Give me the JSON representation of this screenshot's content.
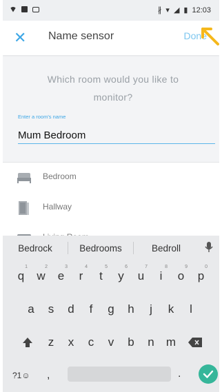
{
  "status_bar": {
    "time": "12:03"
  },
  "app_bar": {
    "title": "Name sensor",
    "done_label": "Done"
  },
  "prompt": {
    "question": "Which room would you like to monitor?"
  },
  "field": {
    "label": "Enter a room's name",
    "value": "Mum Bedroom"
  },
  "rooms": [
    {
      "label": "Bedroom",
      "icon": "bed-icon"
    },
    {
      "label": "Hallway",
      "icon": "door-icon"
    },
    {
      "label": "Living Room",
      "icon": "sofa-icon"
    }
  ],
  "keyboard": {
    "suggestions": [
      "Bedrock",
      "Bedrooms",
      "Bedroll"
    ],
    "row1": [
      {
        "k": "q",
        "h": "1"
      },
      {
        "k": "w",
        "h": "2"
      },
      {
        "k": "e",
        "h": "3"
      },
      {
        "k": "r",
        "h": "4"
      },
      {
        "k": "t",
        "h": "5"
      },
      {
        "k": "y",
        "h": "6"
      },
      {
        "k": "u",
        "h": "7"
      },
      {
        "k": "i",
        "h": "8"
      },
      {
        "k": "o",
        "h": "9"
      },
      {
        "k": "p",
        "h": "0"
      }
    ],
    "row2": [
      "a",
      "s",
      "d",
      "f",
      "g",
      "h",
      "j",
      "k",
      "l"
    ],
    "row3": [
      "z",
      "x",
      "c",
      "v",
      "b",
      "n",
      "m"
    ],
    "symbols_label": "?1☺",
    "comma": ",",
    "period": "."
  },
  "colors": {
    "accent": "#3ea7e6",
    "done": "#7cc6ef",
    "enter": "#36b69a",
    "arrow": "#f5b81c"
  }
}
